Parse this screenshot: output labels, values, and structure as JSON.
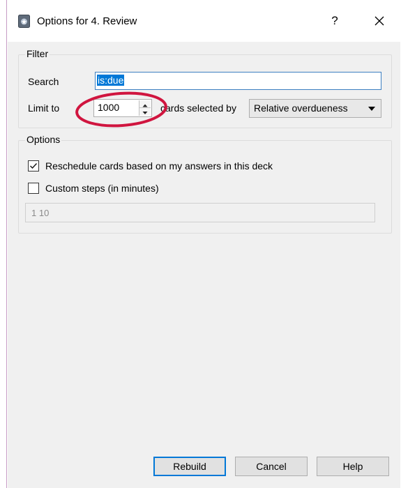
{
  "window": {
    "title": "Options for 4. Review",
    "help_label": "?"
  },
  "filter": {
    "group_title": "Filter",
    "search_label": "Search",
    "search_value": "is:due",
    "limit_label": "Limit to",
    "limit_value": "1000",
    "cards_selected_label": "cards selected by",
    "order_selected": "Relative overdueness"
  },
  "options": {
    "group_title": "Options",
    "reschedule_label": "Reschedule cards based on my answers in this deck",
    "reschedule_checked": true,
    "custom_steps_label": "Custom steps (in minutes)",
    "custom_steps_checked": false,
    "steps_value": "1 10"
  },
  "buttons": {
    "rebuild": "Rebuild",
    "cancel": "Cancel",
    "help": "Help"
  },
  "annotation_color": "#d0153f",
  "accent_color": "#0078d7"
}
